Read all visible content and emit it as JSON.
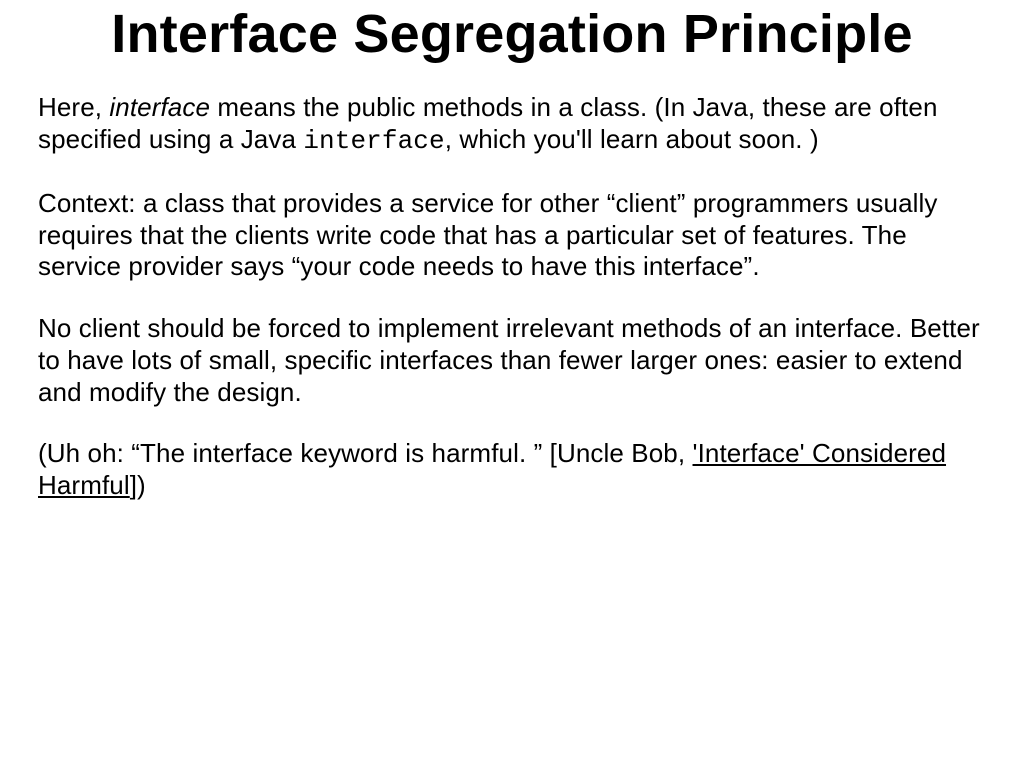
{
  "title": "Interface Segregation Principle",
  "p1": {
    "t1": "Here, ",
    "em": "interface",
    "t2": " means the public methods in a class. (In Java, these are often specified using a Java ",
    "code": "interface",
    "t3": ", which you'll learn about soon. )"
  },
  "p2": "Context: a class that provides a service for other “client” programmers usually requires that the clients write code that has a particular set of features. The service provider says “your code needs to have this interface”.",
  "p3": "No client should be forced to implement irrelevant methods of an interface. Better to have lots of small, specific interfaces than fewer larger ones: easier to extend and modify the design.",
  "p4": {
    "t1": "(Uh oh: “The interface keyword is harmful. ” [Uncle Bob, ",
    "link": "'Interface' Considered Harmful",
    "t2": "])"
  }
}
